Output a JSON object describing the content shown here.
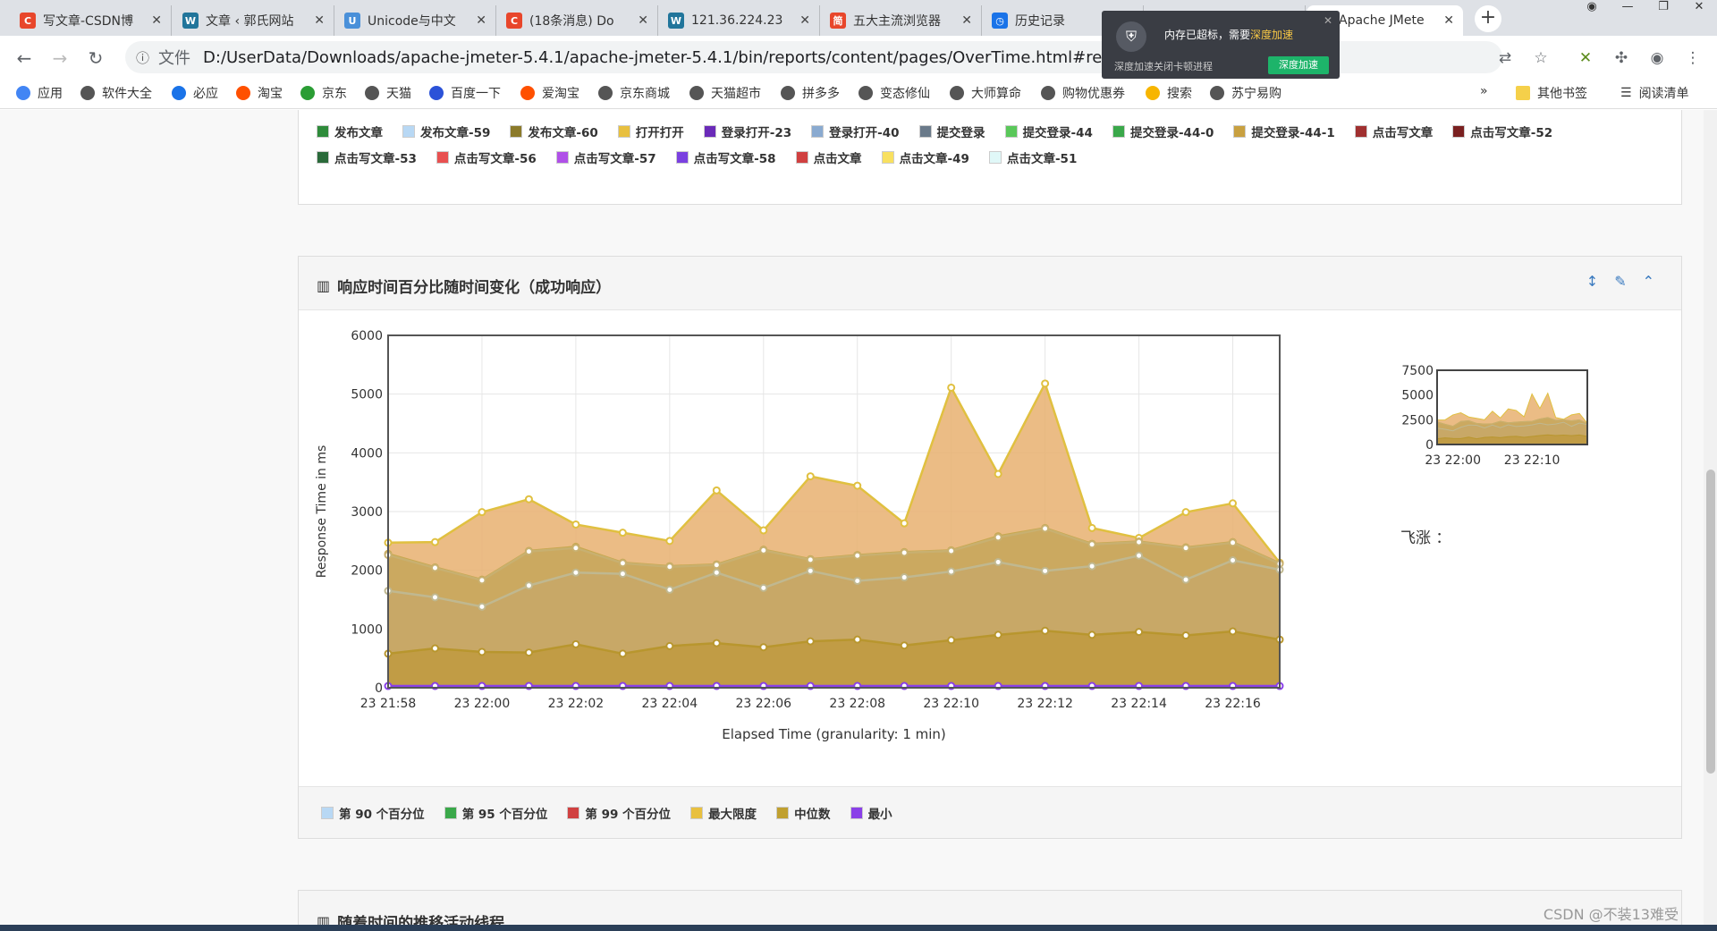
{
  "tabs": [
    {
      "label": "写文章-CSDN博",
      "icon": "C",
      "color": "#e8462b"
    },
    {
      "label": "文章 ‹ 郭氏网站",
      "icon": "W",
      "color": "#21759b"
    },
    {
      "label": "Unicode与中文",
      "icon": "U",
      "color": "#4a90d9"
    },
    {
      "label": "(18条消息) Do",
      "icon": "C",
      "color": "#e8462b"
    },
    {
      "label": "121.36.224.23",
      "icon": "W",
      "color": "#21759b"
    },
    {
      "label": "五大主流浏览器",
      "icon": "简",
      "color": "#e8462b"
    },
    {
      "label": "历史记录",
      "icon": "◷",
      "color": "#1a73e8"
    },
    {
      "label": "Apache JMete",
      "icon": "/",
      "color": "#d04a2a"
    },
    {
      "label": "Apache JMete",
      "icon": "/",
      "color": "#d04a2a"
    }
  ],
  "popup": {
    "message": "内存已超标，需要",
    "highlight": "深度加速",
    "sub": "深度加速关闭卡顿进程",
    "button": "深度加速"
  },
  "address": {
    "label": "文件",
    "url": "D:/UserData/Downloads/apache-jmeter-5.4.1/apache-jmeter-5.4.1/bin/reports/content/pages/OverTime.html#respons"
  },
  "bookmarks": [
    {
      "label": "应用",
      "color": "#4285f4"
    },
    {
      "label": "软件大全",
      "color": "#555"
    },
    {
      "label": "必应",
      "color": "#1a73e8"
    },
    {
      "label": "淘宝",
      "color": "#ff5000"
    },
    {
      "label": "京东",
      "color": "#2a9d34"
    },
    {
      "label": "天猫",
      "color": "#555"
    },
    {
      "label": "百度一下",
      "color": "#2b52d8"
    },
    {
      "label": "爱淘宝",
      "color": "#ff5000"
    },
    {
      "label": "京东商城",
      "color": "#555"
    },
    {
      "label": "天猫超市",
      "color": "#555"
    },
    {
      "label": "拼多多",
      "color": "#555"
    },
    {
      "label": "变态修仙",
      "color": "#555"
    },
    {
      "label": "大师算命",
      "color": "#555"
    },
    {
      "label": "购物优惠券",
      "color": "#555"
    },
    {
      "label": "搜索",
      "color": "#f7b500"
    },
    {
      "label": "苏宁易购",
      "color": "#555"
    }
  ],
  "bookmark_more": "»",
  "bookmark_other": "其他书签",
  "bookmark_reading": "阅读清单",
  "top_legend": [
    {
      "label": "发布文章",
      "color": "#2e8b3a"
    },
    {
      "label": "发布文章-59",
      "color": "#b8d8f4"
    },
    {
      "label": "发布文章-60",
      "color": "#8b7a2a"
    },
    {
      "label": "打开打开",
      "color": "#e8c040"
    },
    {
      "label": "登录打开-23",
      "color": "#6a2ab8"
    },
    {
      "label": "登录打开-40",
      "color": "#8aaad0"
    },
    {
      "label": "提交登录",
      "color": "#6a7a8a"
    },
    {
      "label": "提交登录-44",
      "color": "#5ac85a"
    },
    {
      "label": "提交登录-44-0",
      "color": "#3aa84a"
    },
    {
      "label": "提交登录-44-1",
      "color": "#c8a040"
    },
    {
      "label": "点击写文章",
      "color": "#a03030"
    },
    {
      "label": "点击写文章-52",
      "color": "#7a2020"
    },
    {
      "label": "点击写文章-53",
      "color": "#2a6a3a"
    },
    {
      "label": "点击写文章-56",
      "color": "#e85050"
    },
    {
      "label": "点击写文章-57",
      "color": "#b050e8"
    },
    {
      "label": "点击写文章-58",
      "color": "#7a40e0"
    },
    {
      "label": "点击文章",
      "color": "#d04040"
    },
    {
      "label": "点击文章-49",
      "color": "#f8e060"
    },
    {
      "label": "点击文章-51",
      "color": "#e0f8f8"
    }
  ],
  "panel": {
    "title": "响应时间百分比随时间变化（成功响应）",
    "overview_label": "飞涨 ："
  },
  "bottom_legend": [
    {
      "label": "第 90 个百分位",
      "color": "#b8d8f4"
    },
    {
      "label": "第 95 个百分位",
      "color": "#3aa84a"
    },
    {
      "label": "第 99 个百分位",
      "color": "#d04040"
    },
    {
      "label": "最大限度",
      "color": "#e8c040"
    },
    {
      "label": "中位数",
      "color": "#c0a030"
    },
    {
      "label": "最小",
      "color": "#8a40e8"
    }
  ],
  "next_panel_title": "随着时间的推移活动线程",
  "watermark": "CSDN @不装13难受",
  "chart_data": {
    "type": "area",
    "xlabel": "Elapsed Time (granularity: 1 min)",
    "ylabel": "Response Time in ms",
    "ylim": [
      0,
      6000
    ],
    "yticks": [
      0,
      1000,
      2000,
      3000,
      4000,
      5000,
      6000
    ],
    "xtick_labels": [
      "23 21:58",
      "23 22:00",
      "23 22:02",
      "23 22:04",
      "23 22:06",
      "23 22:08",
      "23 22:10",
      "23 22:12",
      "23 22:14",
      "23 22:16"
    ],
    "x": [
      "21:58",
      "21:59",
      "22:00",
      "22:01",
      "22:02",
      "22:03",
      "22:04",
      "22:05",
      "22:06",
      "22:07",
      "22:08",
      "22:09",
      "22:10",
      "22:11",
      "22:12",
      "22:13",
      "22:14",
      "22:15",
      "22:16",
      "22:17"
    ],
    "series": [
      {
        "name": "最大限度",
        "color": "#e8b070",
        "line": "#e0c040",
        "values": [
          2470,
          2480,
          2990,
          3210,
          2780,
          2640,
          2500,
          3360,
          2680,
          3600,
          3440,
          2800,
          5110,
          3640,
          5180,
          2720,
          2550,
          2990,
          3140,
          2130
        ]
      },
      {
        "name": "第 99 个百分位",
        "color": "#d8a858",
        "line": "#c8a850",
        "values": [
          2280,
          2050,
          1840,
          2330,
          2400,
          2130,
          2070,
          2100,
          2350,
          2190,
          2260,
          2310,
          2340,
          2580,
          2720,
          2450,
          2490,
          2390,
          2480,
          2120
        ]
      },
      {
        "name": "第 95 个百分位",
        "color": "#c8a860",
        "line": "#c8b070",
        "values": [
          2260,
          2040,
          1830,
          2320,
          2380,
          2120,
          2060,
          2090,
          2340,
          2180,
          2250,
          2300,
          2330,
          2560,
          2710,
          2440,
          2480,
          2380,
          2470,
          2110
        ]
      },
      {
        "name": "第 90 个百分位",
        "color": "#c8a868",
        "line": "#c0b890",
        "values": [
          1650,
          1540,
          1380,
          1740,
          1960,
          1940,
          1670,
          1960,
          1700,
          1990,
          1820,
          1880,
          1980,
          2140,
          1990,
          2070,
          2250,
          1840,
          2170,
          2010
        ]
      },
      {
        "name": "中位数",
        "color": "#c09a40",
        "line": "#b8962e",
        "values": [
          580,
          670,
          610,
          600,
          740,
          580,
          710,
          760,
          690,
          790,
          820,
          720,
          810,
          900,
          970,
          900,
          950,
          890,
          960,
          820
        ]
      },
      {
        "name": "最小",
        "color": "#9050e0",
        "line": "#8a40e8",
        "values": [
          30,
          30,
          30,
          30,
          30,
          30,
          30,
          30,
          30,
          30,
          30,
          30,
          30,
          30,
          30,
          30,
          30,
          30,
          30,
          30
        ]
      }
    ],
    "overview": {
      "ylim": [
        0,
        7500
      ],
      "yticks": [
        0,
        2500,
        5000,
        7500
      ],
      "xtick_labels": [
        "23 22:00",
        "23 22:10"
      ]
    }
  }
}
